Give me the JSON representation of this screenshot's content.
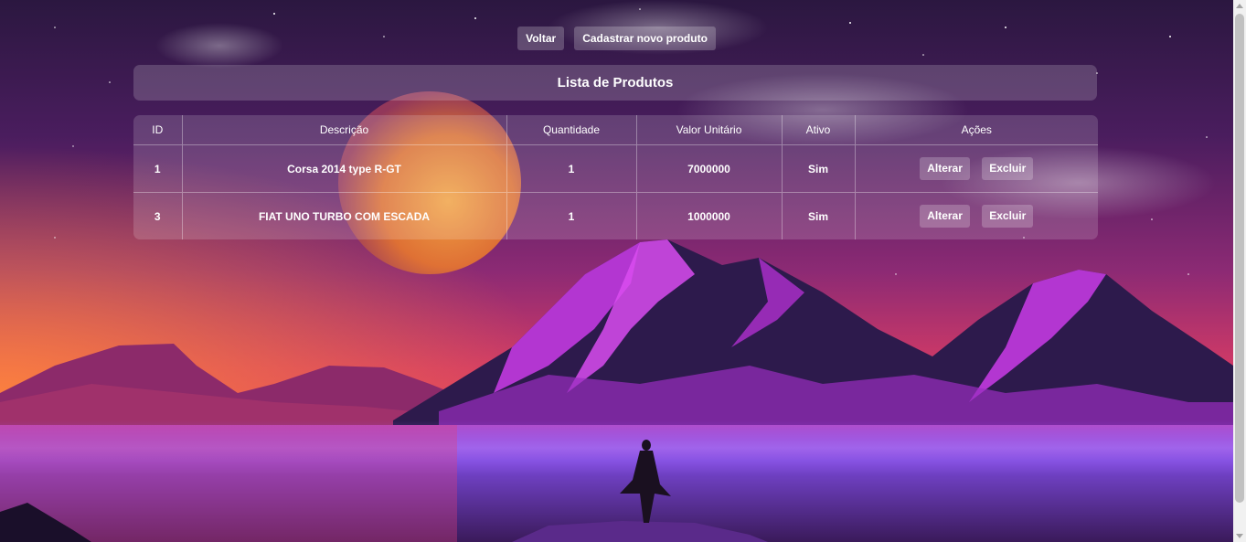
{
  "top_actions": {
    "back_label": "Voltar",
    "new_product_label": "Cadastrar novo produto"
  },
  "page": {
    "title": "Lista de Produtos"
  },
  "table": {
    "headers": {
      "id": "ID",
      "description": "Descrição",
      "quantity": "Quantidade",
      "unit_value": "Valor Unitário",
      "active": "Ativo",
      "actions": "Ações"
    },
    "rows": [
      {
        "id": "1",
        "description": "Corsa 2014 type R-GT",
        "quantity": "1",
        "unit_value": "7000000",
        "active": "Sim",
        "edit_label": "Alterar",
        "delete_label": "Excluir"
      },
      {
        "id": "3",
        "description": "FIAT UNO TURBO COM ESCADA",
        "quantity": "1",
        "unit_value": "1000000",
        "active": "Sim",
        "edit_label": "Alterar",
        "delete_label": "Excluir"
      }
    ]
  },
  "colors": {
    "sky_top": "#2a1a4a",
    "sky_mid": "#8a2a7a",
    "horizon": "#e0406a",
    "mountain_accent": "#c23ae0",
    "water": "#7a3ad0",
    "glass_panel": "#ffffff33"
  }
}
